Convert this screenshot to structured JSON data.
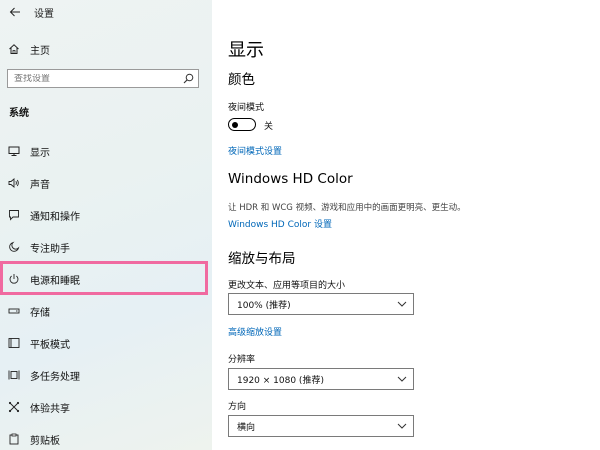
{
  "window": {
    "title": "设置"
  },
  "sidebar": {
    "home_label": "主页",
    "search_placeholder": "查找设置",
    "section_label": "系统",
    "items": [
      {
        "label": "显示",
        "icon": "monitor-icon"
      },
      {
        "label": "声音",
        "icon": "speaker-icon"
      },
      {
        "label": "通知和操作",
        "icon": "notification-icon"
      },
      {
        "label": "专注助手",
        "icon": "moon-icon"
      },
      {
        "label": "电源和睡眠",
        "icon": "power-icon"
      },
      {
        "label": "存储",
        "icon": "storage-icon"
      },
      {
        "label": "平板模式",
        "icon": "tablet-icon"
      },
      {
        "label": "多任务处理",
        "icon": "multitask-icon"
      },
      {
        "label": "体验共享",
        "icon": "share-icon"
      },
      {
        "label": "剪贴板",
        "icon": "clipboard-icon"
      }
    ],
    "highlight_color": "#f06aa0"
  },
  "main": {
    "title": "显示",
    "color_section": {
      "heading": "颜色",
      "night_mode_label": "夜间模式",
      "toggle_state": "关",
      "night_mode_link": "夜间模式设置"
    },
    "hd_section": {
      "heading": "Windows HD Color",
      "description": "让 HDR 和 WCG 视频、游戏和应用中的画面更明亮、更生动。",
      "link": "Windows HD Color 设置"
    },
    "layout_section": {
      "heading": "缩放与布局",
      "scale_label": "更改文本、应用等项目的大小",
      "scale_value": "100% (推荐)",
      "advanced_link": "高级缩放设置",
      "resolution_label": "分辨率",
      "resolution_value": "1920 × 1080 (推荐)",
      "orientation_label": "方向",
      "orientation_value": "横向"
    },
    "link_color": "#0067b8"
  }
}
